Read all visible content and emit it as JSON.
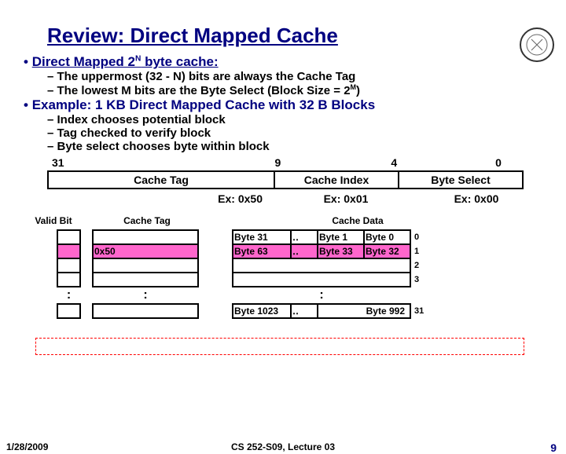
{
  "title": "Review: Direct Mapped Cache",
  "bullets": {
    "l1a_pre": "Direct Mapped 2",
    "l1a_sup": "N",
    "l1a_post": " byte cache:",
    "l1a1": "– The uppermost (32 - N) bits are always the Cache Tag",
    "l1a2_pre": "– The lowest M bits are the Byte Select (Block Size = 2",
    "l1a2_sup": "M",
    "l1a2_post": ")",
    "l1b": "Example: 1 KB Direct Mapped Cache with 32 B Blocks",
    "l1b1": "– Index chooses potential block",
    "l1b2": "– Tag checked to verify block",
    "l1b3": "– Byte select chooses byte within block"
  },
  "addr": {
    "b31": "31",
    "b9": "9",
    "b4": "4",
    "b0": "0",
    "tag": "Cache Tag",
    "idx": "Cache Index",
    "bsel": "Byte Select",
    "ex_tag": "Ex: 0x50",
    "ex_idx": "Ex: 0x01",
    "ex_bsel": "Ex: 0x00"
  },
  "cache": {
    "h_vb": "Valid Bit",
    "h_tag": "Cache Tag",
    "h_data": "Cache Data",
    "tag_row1": "0x50",
    "d_b31": "Byte 31",
    "d_b1": "Byte 1",
    "d_b0": "Byte 0",
    "d_b63": "Byte 63",
    "d_b33": "Byte 33",
    "d_b32": "Byte 32",
    "d_b1023": "Byte 1023",
    "d_b992": "Byte 992",
    "dots": ":",
    "hdots": "‥",
    "idx0": "0",
    "idx1": "1",
    "idx2": "2",
    "idx3": "3",
    "idx31": "31"
  },
  "footer": {
    "date": "1/28/2009",
    "mid": "CS 252-S09, Lecture 03",
    "pg": "9"
  }
}
